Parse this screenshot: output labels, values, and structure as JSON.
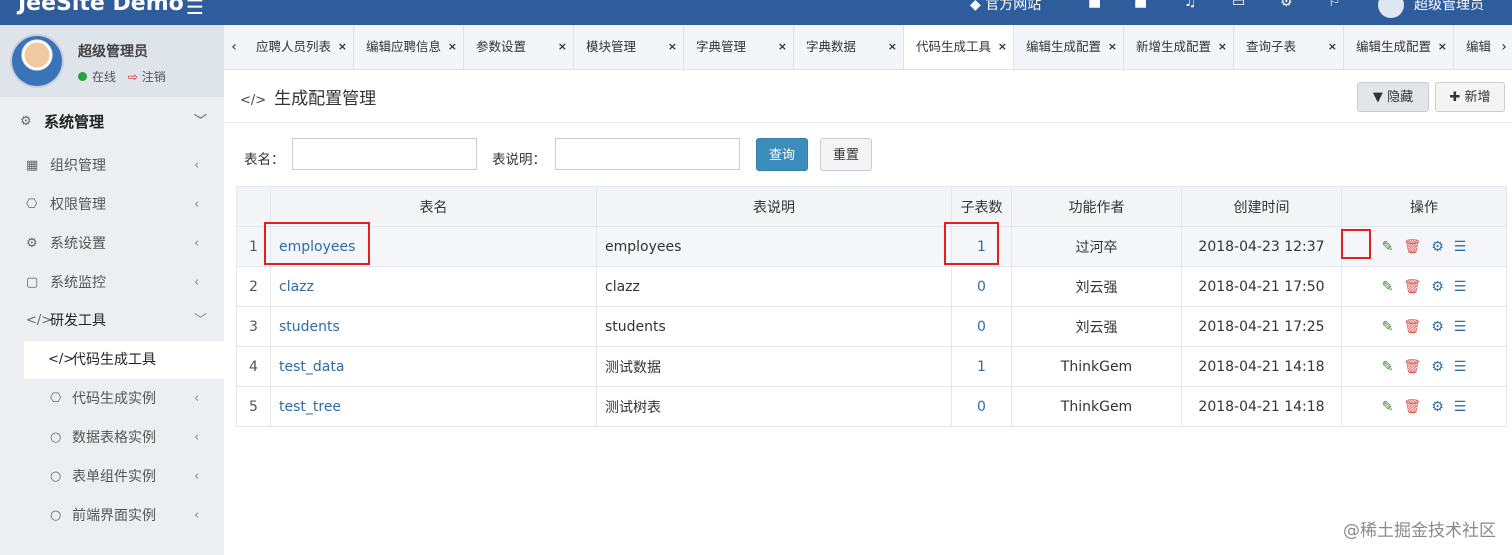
{
  "topbar": {
    "brand": "JeeSite Demo",
    "hamburger": "☰",
    "site_link": "官方网站",
    "user": "超级管理员"
  },
  "sidebar": {
    "user": {
      "name": "超级管理员",
      "status": "在线",
      "logout": "注销"
    },
    "items": [
      {
        "label": "系统管理",
        "icon": "gear-icon",
        "glyph": "⚙",
        "arrow": "﹀",
        "kind": "head"
      },
      {
        "label": "组织管理",
        "icon": "grid-icon",
        "glyph": "▦",
        "arrow": "‹",
        "kind": "item"
      },
      {
        "label": "权限管理",
        "icon": "cluster-icon",
        "glyph": "⎔",
        "arrow": "‹",
        "kind": "item"
      },
      {
        "label": "系统设置",
        "icon": "gear-icon",
        "glyph": "⚙",
        "arrow": "‹",
        "kind": "item"
      },
      {
        "label": "系统监控",
        "icon": "monitor-icon",
        "glyph": "▢",
        "arrow": "‹",
        "kind": "item"
      },
      {
        "label": "研发工具",
        "icon": "code-icon",
        "glyph": "</>",
        "arrow": "﹀",
        "kind": "head2"
      },
      {
        "label": "代码生成工具",
        "icon": "code-icon",
        "glyph": "</>",
        "arrow": "",
        "kind": "active"
      },
      {
        "label": "代码生成实例",
        "icon": "cluster-icon",
        "glyph": "⎔",
        "arrow": "‹",
        "kind": "sub"
      },
      {
        "label": "数据表格实例",
        "icon": "circle-icon",
        "glyph": "○",
        "arrow": "‹",
        "kind": "sub"
      },
      {
        "label": "表单组件实例",
        "icon": "circle-icon",
        "glyph": "○",
        "arrow": "‹",
        "kind": "sub"
      },
      {
        "label": "前端界面实例",
        "icon": "circle-icon",
        "glyph": "○",
        "arrow": "‹",
        "kind": "sub"
      }
    ]
  },
  "tabs": {
    "prev": "‹",
    "next": "›",
    "items": [
      {
        "label": "应聘人员列表",
        "close": "×"
      },
      {
        "label": "编辑应聘信息",
        "close": "×"
      },
      {
        "label": "参数设置",
        "close": "×"
      },
      {
        "label": "模块管理",
        "close": "×"
      },
      {
        "label": "字典管理",
        "close": "×"
      },
      {
        "label": "字典数据",
        "close": "×"
      },
      {
        "label": "代码生成工具",
        "close": "×",
        "active": true
      },
      {
        "label": "编辑生成配置",
        "close": "×"
      },
      {
        "label": "新增生成配置",
        "close": "×"
      },
      {
        "label": "查询子表",
        "close": "×"
      },
      {
        "label": "编辑生成配置",
        "close": "×"
      },
      {
        "label": "编辑",
        "close": ""
      }
    ]
  },
  "page": {
    "title": "生成配置管理",
    "title_icon": "</>",
    "hide_button": "隐藏",
    "new_button": "新增"
  },
  "search": {
    "table_name_label": "表名：",
    "table_name_value": "",
    "table_desc_label": "表说明：",
    "table_desc_value": "",
    "query_button": "查询",
    "reset_button": "重置"
  },
  "table": {
    "columns": [
      "",
      "表名",
      "表说明",
      "子表数",
      "功能作者",
      "创建时间",
      "操作"
    ],
    "rows": [
      {
        "num": "1",
        "name": "employees",
        "desc": "employees",
        "sub": "1",
        "author": "过河卒",
        "time": "2018-04-23 12:37"
      },
      {
        "num": "2",
        "name": "clazz",
        "desc": "clazz",
        "sub": "0",
        "author": "刘云强",
        "time": "2018-04-21 17:50"
      },
      {
        "num": "3",
        "name": "students",
        "desc": "students",
        "sub": "0",
        "author": "刘云强",
        "time": "2018-04-21 17:25"
      },
      {
        "num": "4",
        "name": "test_data",
        "desc": "测试数据",
        "sub": "1",
        "author": "ThinkGem",
        "time": "2018-04-21 14:18"
      },
      {
        "num": "5",
        "name": "test_tree",
        "desc": "测试树表",
        "sub": "0",
        "author": "ThinkGem",
        "time": "2018-04-21 14:18"
      }
    ],
    "ops": {
      "edit": "✎",
      "delete": "🗑",
      "generate": "⚙",
      "more": "☰"
    }
  },
  "colors": {
    "primary": "#3c8dbc",
    "topbar": "#2f5d9c",
    "link": "#2e6da4",
    "highlight": "#e02020"
  },
  "watermark": "@稀土掘金技术社区"
}
